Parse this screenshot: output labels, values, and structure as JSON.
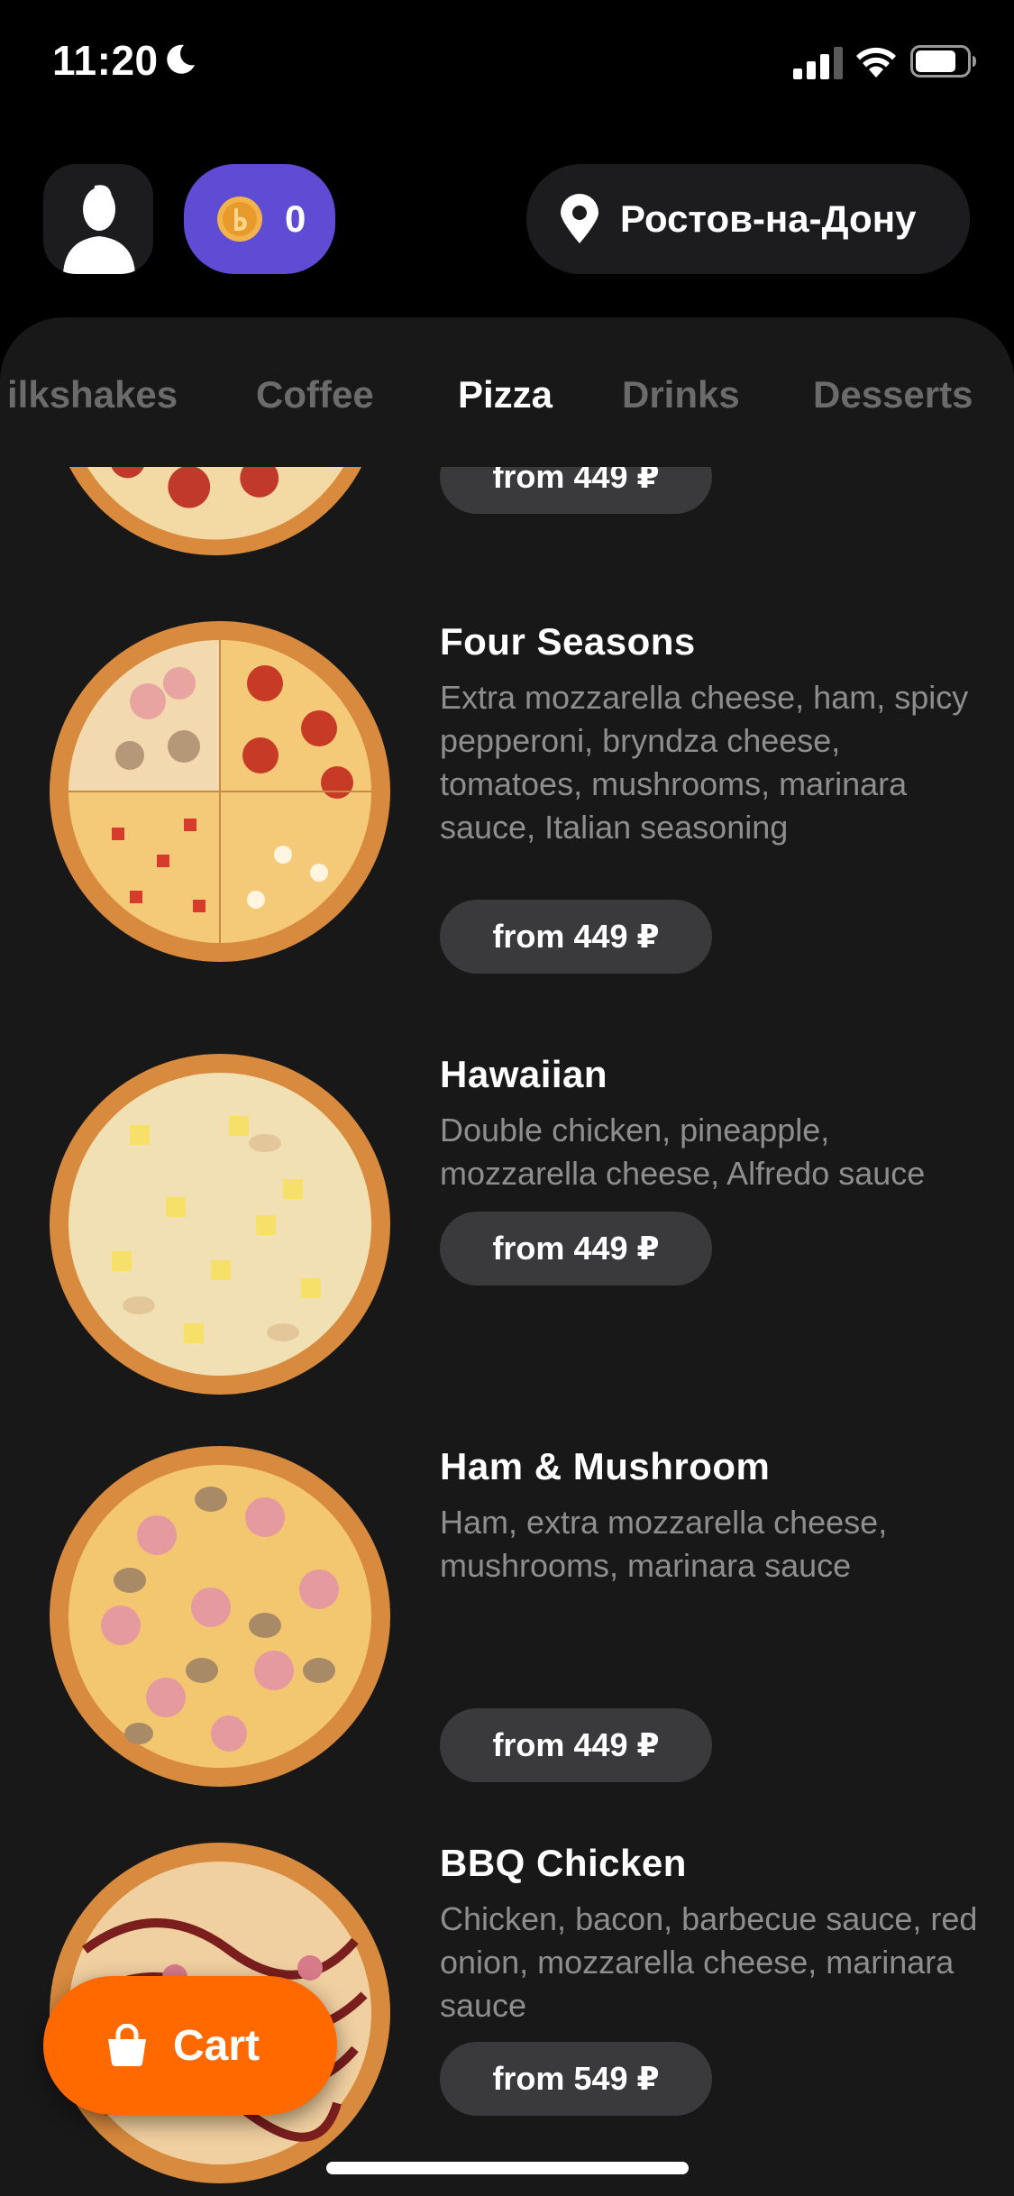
{
  "status_bar": {
    "time": "11:20"
  },
  "header": {
    "coins": "0",
    "location": "Ростов-на-Дону"
  },
  "tabs": [
    "ilkshakes",
    "Coffee",
    "Pizza",
    "Drinks",
    "Desserts"
  ],
  "active_tab": "Pizza",
  "menu": {
    "partial_item": {
      "price": "from 449 ₽"
    },
    "items": [
      {
        "name": "Four Seasons",
        "description": "Extra mozzarella cheese, ham, spicy pepperoni, bryndza cheese, tomatoes, mushrooms, marinara sauce, Italian seasoning",
        "price": "from 449 ₽"
      },
      {
        "name": "Hawaiian",
        "description": "Double chicken, pineapple, mozzarella cheese, Alfredo sauce",
        "price": "from 449 ₽"
      },
      {
        "name": "Ham & Mushroom",
        "description": "Ham, extra mozzarella cheese, mushrooms, marinara sauce",
        "price": "from 449 ₽"
      },
      {
        "name": "BBQ Chicken",
        "description": "Chicken, bacon, barbecue sauce, red onion, mozzarella cheese, marinara sauce",
        "price": "from 549 ₽"
      }
    ]
  },
  "cart": {
    "label": "Cart"
  },
  "colors": {
    "accent": "#ff6900",
    "coin_button": "#5f4bd4",
    "background": "#000000",
    "panel": "#181818"
  }
}
